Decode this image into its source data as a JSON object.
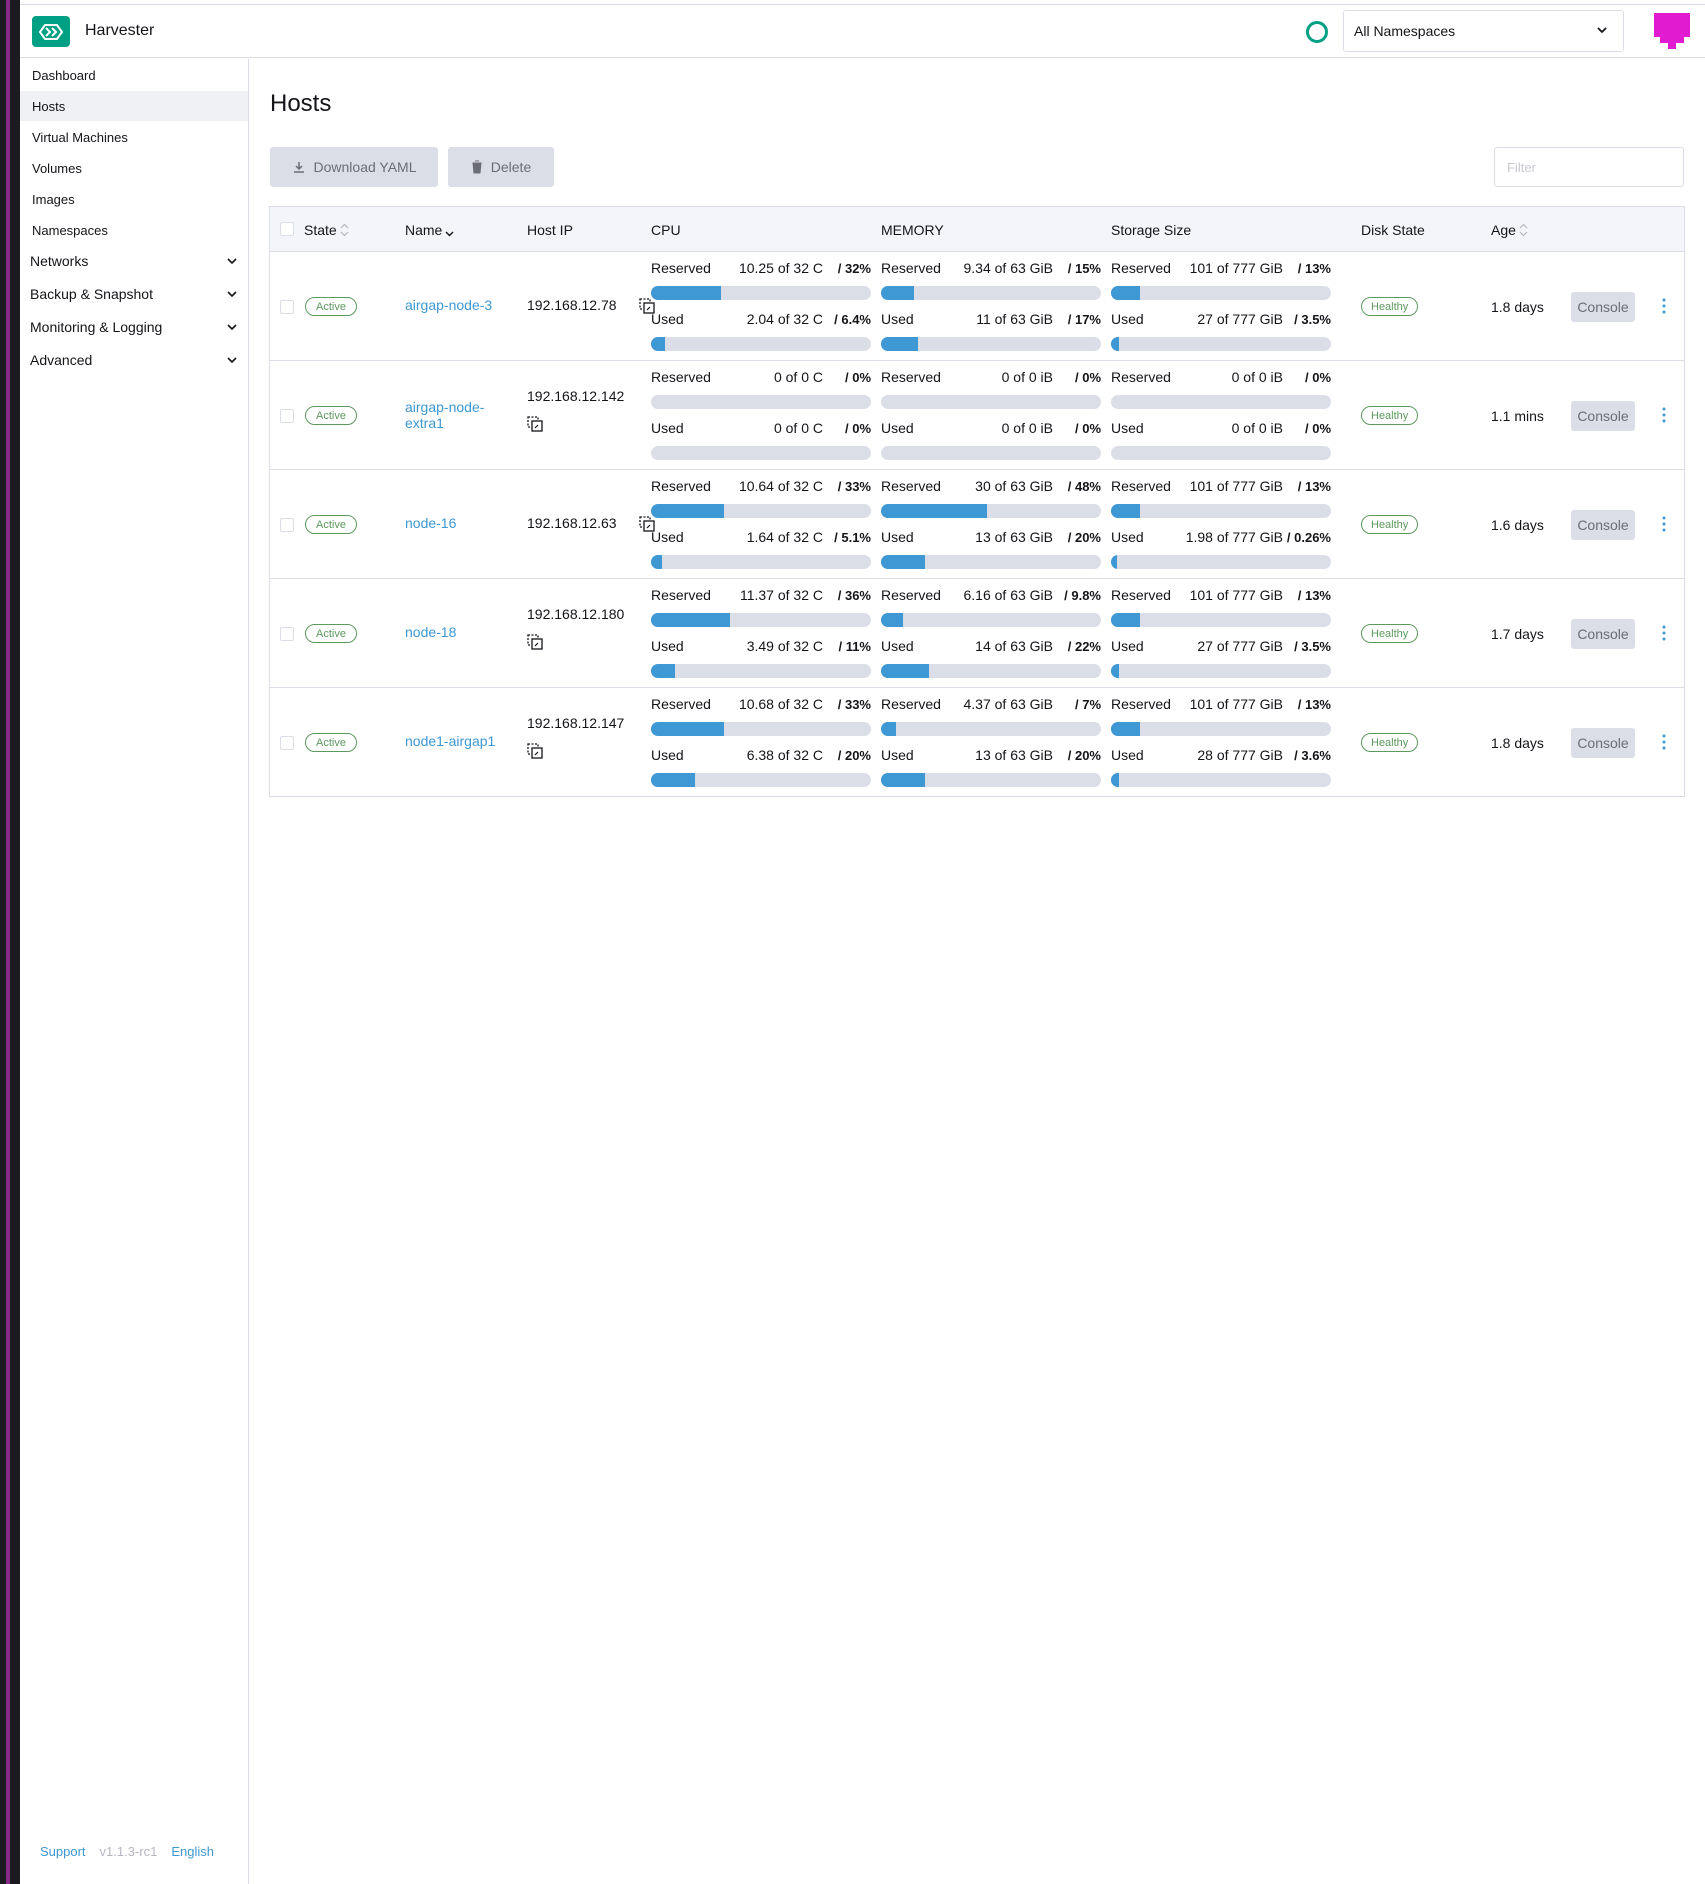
{
  "app": {
    "title": "Harvester"
  },
  "header": {
    "namespace_selected": "All Namespaces"
  },
  "sidebar": {
    "items": [
      {
        "label": "Dashboard"
      },
      {
        "label": "Hosts"
      },
      {
        "label": "Virtual Machines"
      },
      {
        "label": "Volumes"
      },
      {
        "label": "Images"
      },
      {
        "label": "Namespaces"
      }
    ],
    "groups": [
      {
        "label": "Networks"
      },
      {
        "label": "Backup & Snapshot"
      },
      {
        "label": "Monitoring & Logging"
      },
      {
        "label": "Advanced"
      }
    ],
    "footer": {
      "support": "Support",
      "version": "v1.1.3-rc1",
      "language": "English"
    }
  },
  "page": {
    "title": "Hosts",
    "download_label": "Download YAML",
    "delete_label": "Delete",
    "filter_placeholder": "Filter"
  },
  "table": {
    "columns": {
      "state": "State",
      "name": "Name",
      "host_ip": "Host IP",
      "cpu": "CPU",
      "memory": "MEMORY",
      "storage": "Storage Size",
      "disk_state": "Disk State",
      "age": "Age"
    },
    "labels": {
      "reserved": "Reserved",
      "used": "Used",
      "console": "Console"
    },
    "rows": [
      {
        "state": "Active",
        "name": "airgap-node-3",
        "host_ip": "192.168.12.78",
        "cpu": {
          "reserved": "10.25 of 32 C",
          "reserved_pct": "/ 32%",
          "reserved_frac": 0.32,
          "used": "2.04 of 32 C",
          "used_pct": "/ 6.4%",
          "used_frac": 0.064
        },
        "memory": {
          "reserved": "9.34 of 63 GiB",
          "reserved_pct": "/ 15%",
          "reserved_frac": 0.15,
          "used": "11 of 63 GiB",
          "used_pct": "/ 17%",
          "used_frac": 0.17
        },
        "storage": {
          "reserved": "101 of 777 GiB",
          "reserved_pct": "/ 13%",
          "reserved_frac": 0.13,
          "used": "27 of 777 GiB",
          "used_pct": "/ 3.5%",
          "used_frac": 0.035
        },
        "disk_state": "Healthy",
        "age": "1.8 days"
      },
      {
        "state": "Active",
        "name": "airgap-node-extra1",
        "host_ip": "192.168.12.142",
        "cpu": {
          "reserved": "0 of 0 C",
          "reserved_pct": "/ 0%",
          "reserved_frac": 0,
          "used": "0 of 0 C",
          "used_pct": "/ 0%",
          "used_frac": 0
        },
        "memory": {
          "reserved": "0 of 0 iB",
          "reserved_pct": "/ 0%",
          "reserved_frac": 0,
          "used": "0 of 0 iB",
          "used_pct": "/ 0%",
          "used_frac": 0
        },
        "storage": {
          "reserved": "0 of 0 iB",
          "reserved_pct": "/ 0%",
          "reserved_frac": 0,
          "used": "0 of 0 iB",
          "used_pct": "/ 0%",
          "used_frac": 0
        },
        "disk_state": "Healthy",
        "age": "1.1 mins"
      },
      {
        "state": "Active",
        "name": "node-16",
        "host_ip": "192.168.12.63",
        "cpu": {
          "reserved": "10.64 of 32 C",
          "reserved_pct": "/ 33%",
          "reserved_frac": 0.33,
          "used": "1.64 of 32 C",
          "used_pct": "/ 5.1%",
          "used_frac": 0.051
        },
        "memory": {
          "reserved": "30 of 63 GiB",
          "reserved_pct": "/ 48%",
          "reserved_frac": 0.48,
          "used": "13 of 63 GiB",
          "used_pct": "/ 20%",
          "used_frac": 0.2
        },
        "storage": {
          "reserved": "101 of 777 GiB",
          "reserved_pct": "/ 13%",
          "reserved_frac": 0.13,
          "used": "1.98 of 777 GiB",
          "used_pct": "/ 0.26%",
          "used_frac": 0.0026
        },
        "disk_state": "Healthy",
        "age": "1.6 days"
      },
      {
        "state": "Active",
        "name": "node-18",
        "host_ip": "192.168.12.180",
        "cpu": {
          "reserved": "11.37 of 32 C",
          "reserved_pct": "/ 36%",
          "reserved_frac": 0.36,
          "used": "3.49 of 32 C",
          "used_pct": "/ 11%",
          "used_frac": 0.11
        },
        "memory": {
          "reserved": "6.16 of 63 GiB",
          "reserved_pct": "/ 9.8%",
          "reserved_frac": 0.098,
          "used": "14 of 63 GiB",
          "used_pct": "/ 22%",
          "used_frac": 0.22
        },
        "storage": {
          "reserved": "101 of 777 GiB",
          "reserved_pct": "/ 13%",
          "reserved_frac": 0.13,
          "used": "27 of 777 GiB",
          "used_pct": "/ 3.5%",
          "used_frac": 0.035
        },
        "disk_state": "Healthy",
        "age": "1.7 days"
      },
      {
        "state": "Active",
        "name": "node1-airgap1",
        "host_ip": "192.168.12.147",
        "cpu": {
          "reserved": "10.68 of 32 C",
          "reserved_pct": "/ 33%",
          "reserved_frac": 0.33,
          "used": "6.38 of 32 C",
          "used_pct": "/ 20%",
          "used_frac": 0.2
        },
        "memory": {
          "reserved": "4.37 of 63 GiB",
          "reserved_pct": "/ 7%",
          "reserved_frac": 0.07,
          "used": "13 of 63 GiB",
          "used_pct": "/ 20%",
          "used_frac": 0.2
        },
        "storage": {
          "reserved": "101 of 777 GiB",
          "reserved_pct": "/ 13%",
          "reserved_frac": 0.13,
          "used": "28 of 777 GiB",
          "used_pct": "/ 3.6%",
          "used_frac": 0.036
        },
        "disk_state": "Healthy",
        "age": "1.8 days"
      }
    ]
  },
  "colors": {
    "brand": "#00a085",
    "link": "#3d98d3",
    "bar_fill": "#3d98d3",
    "bar_track": "#dcdee7",
    "status_ok": "#5d995d",
    "avatar": "#e01bd0"
  },
  "icons": [
    "harvester-logo-icon",
    "status-circle-icon",
    "chevron-down-icon",
    "download-icon",
    "trash-icon",
    "sort-icon",
    "copy-icon",
    "kebab-menu-icon",
    "avatar-icon"
  ]
}
